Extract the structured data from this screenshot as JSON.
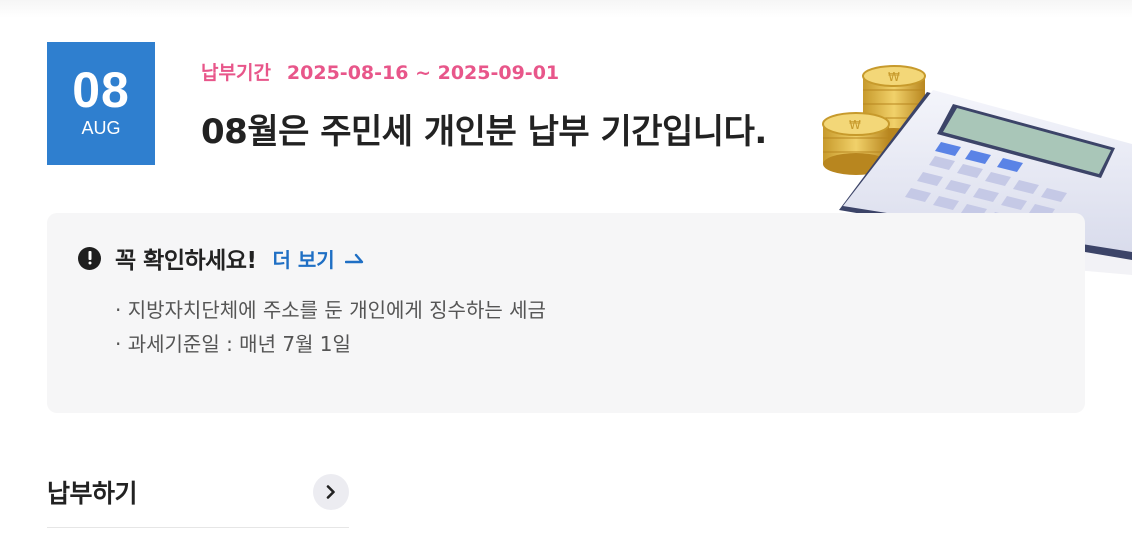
{
  "date_badge": {
    "day": "08",
    "month": "AUG"
  },
  "period": {
    "label": "납부기간",
    "range": "2025-08-16 ~ 2025-09-01"
  },
  "headline": "08월은 주민세 개인분 납부 기간입니다.",
  "notice": {
    "title": "꼭 확인하세요!",
    "more_label": "더 보기",
    "items": [
      "지방자치단체에 주소를 둔 개인에게 징수하는 세금",
      "과세기준일 : 매년 7월 1일"
    ]
  },
  "pay": {
    "title": "납부하기"
  },
  "icons": {
    "alert": "exclamation-circle-icon",
    "more": "arrow-right-icon",
    "pay": "chevron-right-icon",
    "illustration": "calculator-coins-illustration"
  },
  "colors": {
    "badge": "#2f7fcf",
    "period": "#e8568a",
    "link": "#1f6fc4",
    "notice_bg": "#f6f6f7"
  }
}
